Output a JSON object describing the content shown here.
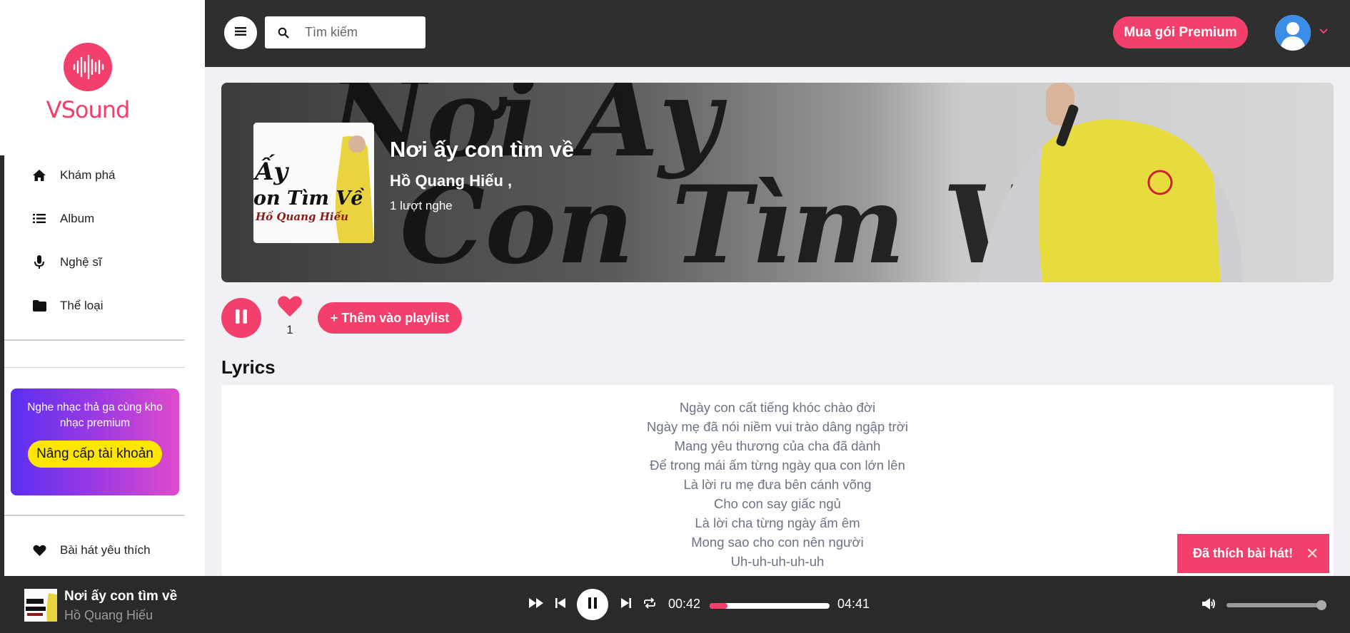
{
  "brand": {
    "name": "VSound",
    "accent": "#f33f6c"
  },
  "sidebar": {
    "items": [
      {
        "label": "Khám phá",
        "icon": "home-icon"
      },
      {
        "label": "Album",
        "icon": "list-icon"
      },
      {
        "label": "Nghệ sĩ",
        "icon": "microphone-icon"
      },
      {
        "label": "Thể loại",
        "icon": "folder-icon"
      }
    ],
    "promo": {
      "text": "Nghe nhạc thả ga cùng kho nhạc premium",
      "button": "Nâng cấp tài khoản"
    },
    "favorites": {
      "label": "Bài hát yêu thích",
      "icon": "heart-icon"
    }
  },
  "header": {
    "search_placeholder": "Tìm kiếm",
    "premium_button": "Mua gói Premium"
  },
  "song": {
    "title": "Nơi ấy con tìm về",
    "artist": "Hồ Quang Hiếu ,",
    "plays": "1 lượt nghe",
    "like_count": "1",
    "add_playlist": "+ Thêm vào playlist",
    "banner_text_1": "Nơi Ấy",
    "banner_text_2": "Con Tìm Về",
    "cover_lines": [
      "Ấy",
      "on Tìm Về",
      "Hồ Quang Hiếu"
    ]
  },
  "lyrics": {
    "heading": "Lyrics",
    "lines": [
      "Ngày con cất tiếng khóc chào đời",
      "Ngày mẹ đã nói niềm vui trào dâng ngập trời",
      "Mang yêu thương của cha đã dành",
      "Để trong mái ấm từng ngày qua con lớn lên",
      "Là lời ru mẹ đưa bên cánh võng",
      "Cho con say giấc ngủ",
      "Là lời cha từng ngày ấm êm",
      "Mong sao cho con nên người",
      "Uh-uh-uh-uh-uh"
    ]
  },
  "toast": {
    "text": "Đã thích bài hát!",
    "close": "✕"
  },
  "player": {
    "title": "Nơi ấy con tìm về",
    "artist": "Hồ Quang Hiếu",
    "current_time": "00:42",
    "total_time": "04:41",
    "progress": 0.15,
    "volume": 1.0
  }
}
